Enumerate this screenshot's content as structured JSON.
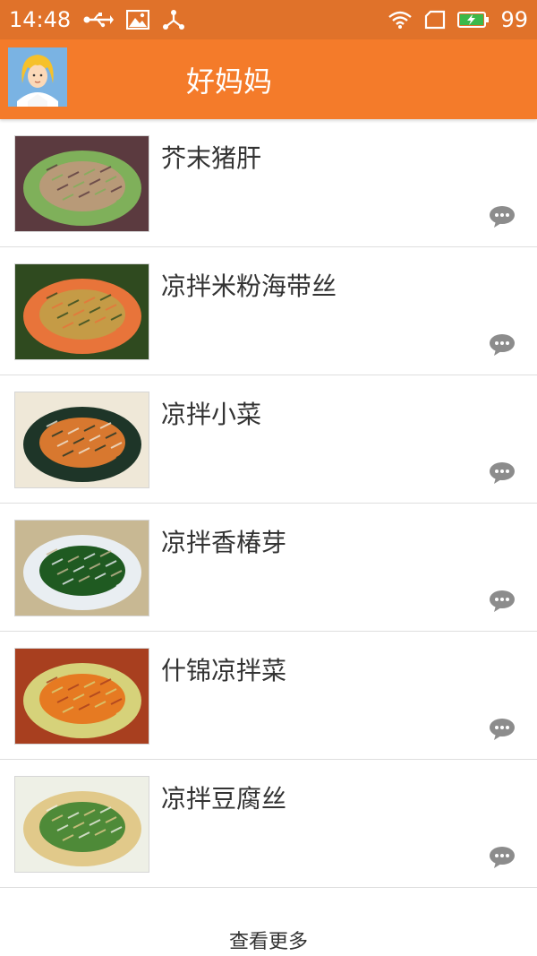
{
  "status_bar": {
    "time": "14:48",
    "battery": "99",
    "icons": [
      "usb-icon",
      "image-icon",
      "share-icon",
      "wifi-icon",
      "sim-icon",
      "battery-charging-icon"
    ]
  },
  "app_bar": {
    "title": "好妈妈",
    "avatar_icon": "avatar-girl-icon"
  },
  "recipes": [
    {
      "name": "芥末猪肝",
      "thumb_colors": [
        "#5b3a3f",
        "#b89a78",
        "#7fb05a"
      ]
    },
    {
      "name": "凉拌米粉海带丝",
      "thumb_colors": [
        "#2f4a1f",
        "#c59b46",
        "#e8743a"
      ]
    },
    {
      "name": "凉拌小菜",
      "thumb_colors": [
        "#efe8d8",
        "#d8782f",
        "#1e3528"
      ]
    },
    {
      "name": "凉拌香椿芽",
      "thumb_colors": [
        "#c8b893",
        "#1f5a21",
        "#e9eef2"
      ]
    },
    {
      "name": "什锦凉拌菜",
      "thumb_colors": [
        "#a83f1f",
        "#e67a22",
        "#d6d27a"
      ]
    },
    {
      "name": "凉拌豆腐丝",
      "thumb_colors": [
        "#eef0e6",
        "#4e8a38",
        "#e1c98a"
      ]
    }
  ],
  "footer": {
    "more_label": "查看更多"
  },
  "colors": {
    "status_bar": "#e0722a",
    "app_bar": "#f47b2a",
    "comment_icon": "#8c8c8c"
  }
}
